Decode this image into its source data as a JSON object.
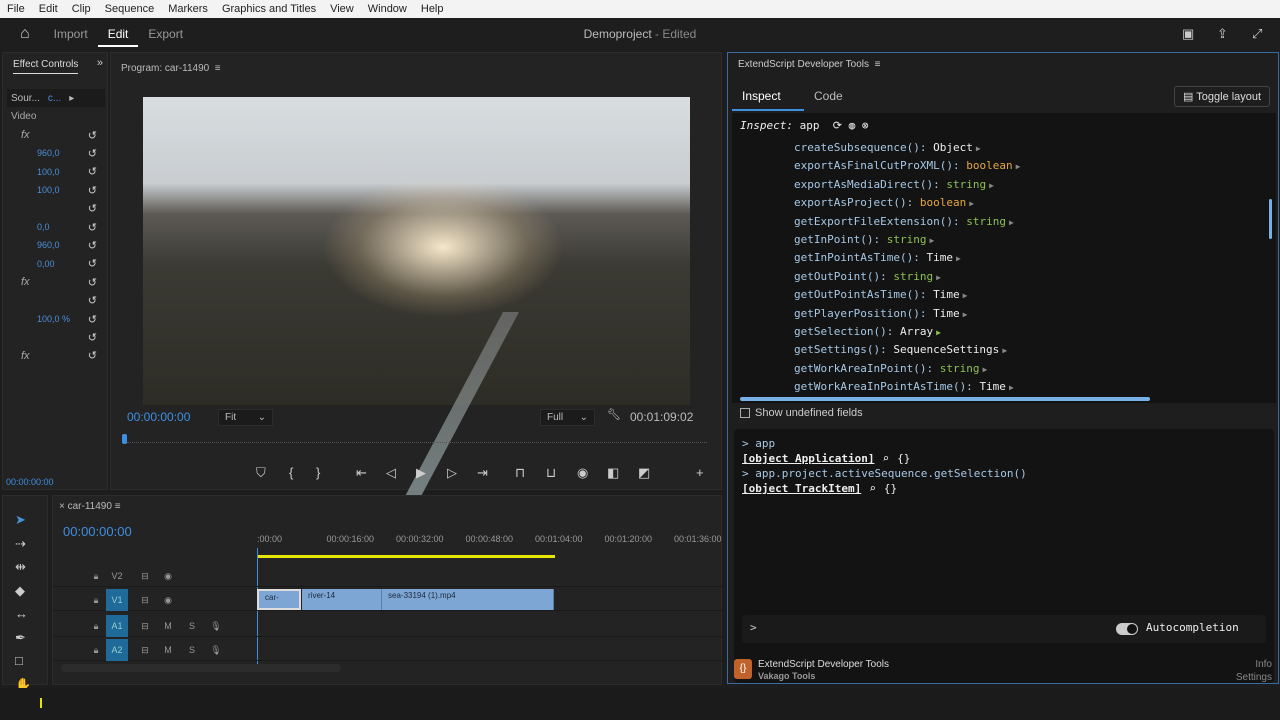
{
  "menu": [
    "File",
    "Edit",
    "Clip",
    "Sequence",
    "Markers",
    "Graphics and Titles",
    "View",
    "Window",
    "Help"
  ],
  "header": {
    "workspaces": [
      "Import",
      "Edit",
      "Export"
    ],
    "active": "Edit",
    "project": "Demoproject",
    "edited": "- Edited"
  },
  "effect_controls": {
    "tab": "Effect Controls",
    "source": "Sour...",
    "clip": "c...",
    "video_label": "Video",
    "rows": [
      "fx",
      "960,0",
      "100,0",
      "100,0",
      "",
      "0,0",
      "960,0",
      "0,00",
      "fx",
      "",
      "100,0 %",
      "",
      "fx"
    ],
    "timecode": "00:00:00:00"
  },
  "program": {
    "title": "Program: car-11490",
    "timecode": "00:00:00:00",
    "fit": "Fit",
    "quality": "Full",
    "duration": "00:01:09:02"
  },
  "timeline": {
    "sequence": "car-11490",
    "timecode": "00:00:00:00",
    "ruler": [
      ":00:00",
      "00:00:16:00",
      "00:00:32:00",
      "00:00:48:00",
      "00:01:04:00",
      "00:01:20:00",
      "00:01:36:00"
    ],
    "tracks": [
      {
        "name": "V2",
        "type": "video"
      },
      {
        "name": "V1",
        "type": "video"
      },
      {
        "name": "A1",
        "type": "audio"
      },
      {
        "name": "A2",
        "type": "audio"
      }
    ],
    "clips": [
      "car-",
      "river-14",
      "sea-33194 (1).mp4"
    ],
    "mute": "M",
    "solo": "S"
  },
  "esdt": {
    "title": "ExtendScript Developer Tools",
    "tabs": [
      "Inspect",
      "Code"
    ],
    "active_tab": "Inspect",
    "toggle_layout": "Toggle layout",
    "inspect_label": "Inspect:",
    "inspect_target": "app",
    "members": [
      {
        "name": "createSubsequence():",
        "type": "Object",
        "kind": "white"
      },
      {
        "name": "exportAsFinalCutProXML():",
        "type": "boolean",
        "kind": "boolean"
      },
      {
        "name": "exportAsMediaDirect():",
        "type": "string",
        "kind": "string"
      },
      {
        "name": "exportAsProject():",
        "type": "boolean",
        "kind": "boolean"
      },
      {
        "name": "getExportFileExtension():",
        "type": "string",
        "kind": "string"
      },
      {
        "name": "getInPoint():",
        "type": "string",
        "kind": "string"
      },
      {
        "name": "getInPointAsTime():",
        "type": "Time",
        "kind": "white"
      },
      {
        "name": "getOutPoint():",
        "type": "string",
        "kind": "string"
      },
      {
        "name": "getOutPointAsTime():",
        "type": "Time",
        "kind": "white"
      },
      {
        "name": "getPlayerPosition():",
        "type": "Time",
        "kind": "white"
      },
      {
        "name": "getSelection():",
        "type": "Array",
        "kind": "white"
      },
      {
        "name": "getSettings():",
        "type": "SequenceSettings",
        "kind": "white"
      },
      {
        "name": "getWorkAreaInPoint():",
        "type": "string",
        "kind": "string"
      },
      {
        "name": "getWorkAreaInPointAsTime():",
        "type": "Time",
        "kind": "white"
      }
    ],
    "show_undefined": "Show undefined fields",
    "console": [
      {
        "kind": "cmd",
        "text": "> app"
      },
      {
        "kind": "obj",
        "text": "[object Application]"
      },
      {
        "kind": "cmd",
        "text": "> app.project.activeSequence.getSelection()"
      },
      {
        "kind": "obj",
        "text": "[object TrackItem]"
      }
    ],
    "prompt": ">",
    "autocompletion": "Autocompletion",
    "autocompletion_on": true,
    "footer_title": "ExtendScript Developer Tools",
    "footer_vendor": "Vakago Tools",
    "info": "Info",
    "settings": "Settings"
  },
  "colors": {
    "accent": "#3e8fe0",
    "clip": "#7ea6d4",
    "boolean": "#e6a640",
    "string": "#8cc152",
    "workarea": "#e6e600"
  }
}
